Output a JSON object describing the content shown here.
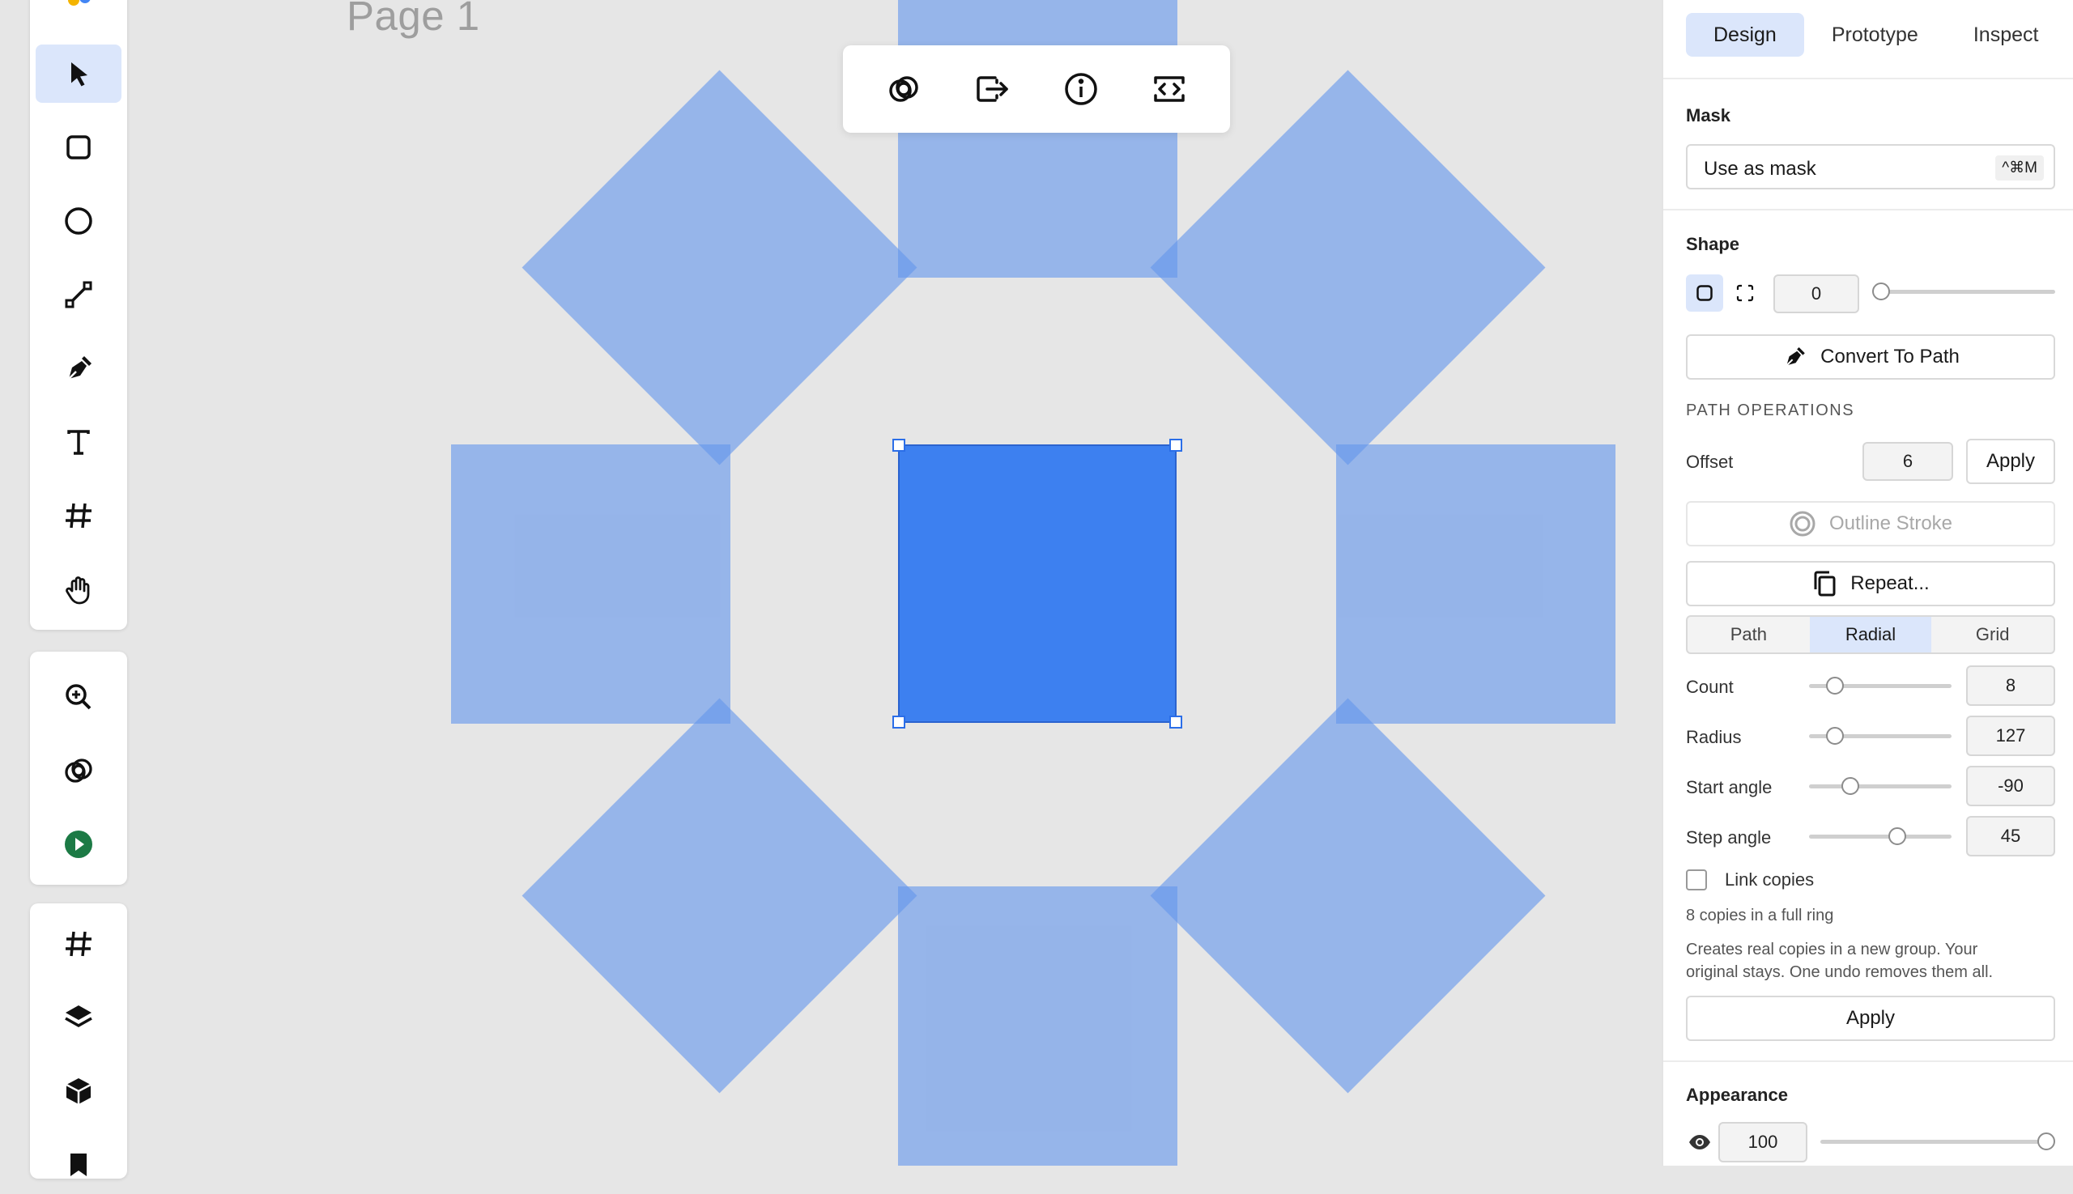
{
  "canvas": {
    "page_label": "Page 1",
    "copy_color": "#6496eb",
    "selected_color": "#3d80f0"
  },
  "context_toolbar": {
    "icons": [
      "boolean-icon",
      "export-icon",
      "info-icon",
      "code-icon"
    ]
  },
  "left_toolbar": {
    "tools": [
      "select-icon",
      "rectangle-icon",
      "ellipse-icon",
      "line-icon",
      "pen-icon",
      "text-icon",
      "frame-icon",
      "hand-icon"
    ],
    "utility": [
      "zoom-icon",
      "boolean-icon",
      "play-icon"
    ],
    "panels": [
      "frame-icon",
      "layers-icon",
      "components-icon"
    ]
  },
  "panel": {
    "tabs": [
      "Design",
      "Prototype",
      "Inspect"
    ],
    "active_tab": "Design",
    "mask": {
      "title": "Mask",
      "use_as_mask": "Use as mask",
      "shortcut": "^⌘M"
    },
    "shape": {
      "title": "Shape",
      "corner_radius": "0",
      "corner_radius_fraction": 0.0,
      "convert_label": "Convert To Path"
    },
    "path_ops": {
      "caption": "PATH OPERATIONS",
      "offset_label": "Offset",
      "offset_value": "6",
      "apply_label": "Apply",
      "outline_label": "Outline Stroke",
      "repeat_label": "Repeat..."
    },
    "repeat": {
      "modes": [
        "Path",
        "Radial",
        "Grid"
      ],
      "active_mode": "Radial",
      "count_label": "Count",
      "count_value": "8",
      "radius_label": "Radius",
      "radius_value": "127",
      "start_label": "Start angle",
      "start_value": "-90",
      "step_label": "Step angle",
      "step_value": "45",
      "link_label": "Link copies",
      "summary": "8 copies in a full ring",
      "help_line1": "Creates real copies in a new group. Your",
      "help_line2": "original stays. One undo removes them all.",
      "apply_label": "Apply"
    },
    "appearance": {
      "title": "Appearance",
      "opacity": "100"
    }
  }
}
